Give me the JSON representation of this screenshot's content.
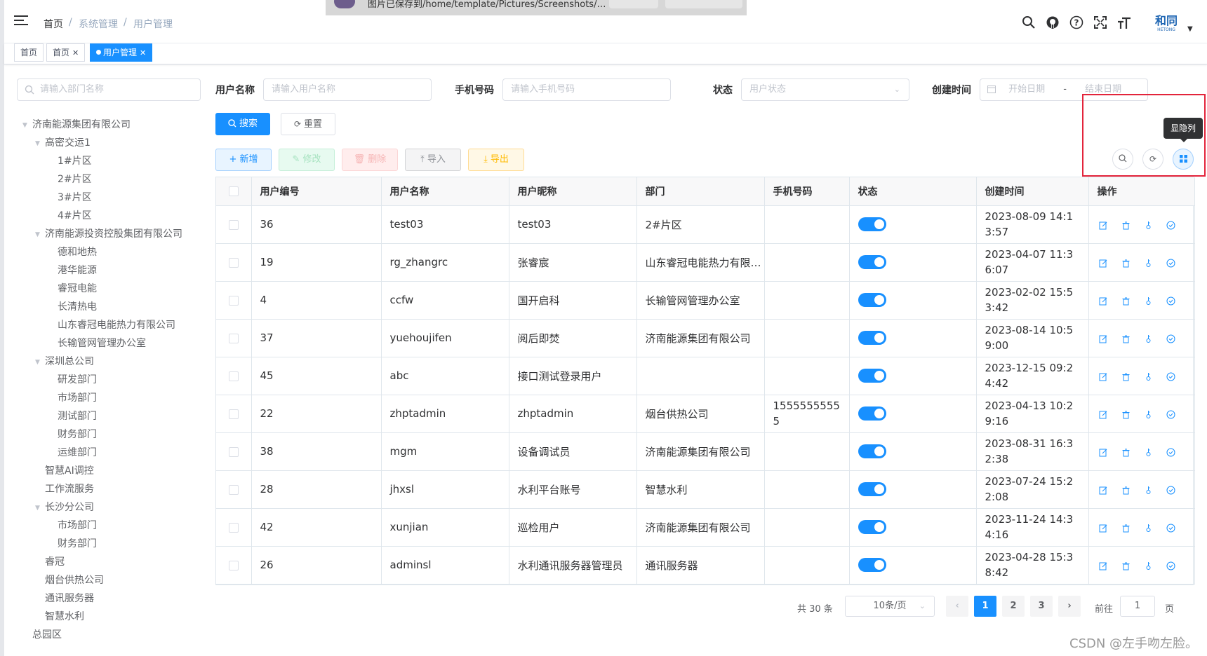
{
  "navbar": {
    "breadcrumb": [
      "首页",
      "系统管理",
      "用户管理"
    ],
    "separator": "/"
  },
  "notification": {
    "text": "图片已保存到/home/template/Pictures/Screenshots/…"
  },
  "logo": {
    "text": "和同",
    "subtext": "HETONG"
  },
  "tags": [
    {
      "label": "首页"
    },
    {
      "label": "首页"
    },
    {
      "label": "用户管理"
    }
  ],
  "dept_search": {
    "placeholder": "请输入部门名称"
  },
  "tree": [
    {
      "label": "济南能源集团有限公司",
      "level": 0,
      "expanded": true
    },
    {
      "label": "高密交运1",
      "level": 1,
      "expanded": true
    },
    {
      "label": "1#片区",
      "level": 2
    },
    {
      "label": "2#片区",
      "level": 2
    },
    {
      "label": "3#片区",
      "level": 2
    },
    {
      "label": "4#片区",
      "level": 2
    },
    {
      "label": "济南能源投资控股集团有限公司",
      "level": 1,
      "expanded": true
    },
    {
      "label": "德和地热",
      "level": 2
    },
    {
      "label": "港华能源",
      "level": 2
    },
    {
      "label": "睿冠电能",
      "level": 2
    },
    {
      "label": "长清热电",
      "level": 2
    },
    {
      "label": "山东睿冠电能热力有限公司",
      "level": 2
    },
    {
      "label": "长输管网管理办公室",
      "level": 2
    },
    {
      "label": "深圳总公司",
      "level": 1,
      "expanded": true
    },
    {
      "label": "研发部门",
      "level": 2
    },
    {
      "label": "市场部门",
      "level": 2
    },
    {
      "label": "测试部门",
      "level": 2
    },
    {
      "label": "财务部门",
      "level": 2
    },
    {
      "label": "运维部门",
      "level": 2
    },
    {
      "label": "智慧AI调控",
      "level": 1
    },
    {
      "label": "工作流服务",
      "level": 1
    },
    {
      "label": "长沙分公司",
      "level": 1,
      "expanded": true
    },
    {
      "label": "市场部门",
      "level": 2
    },
    {
      "label": "财务部门",
      "level": 2
    },
    {
      "label": "睿冠",
      "level": 1
    },
    {
      "label": "烟台供热公司",
      "level": 1
    },
    {
      "label": "通讯服务器",
      "level": 1
    },
    {
      "label": "智慧水利",
      "level": 1
    },
    {
      "label": "总园区",
      "level": 0
    }
  ],
  "filters": {
    "username_label": "用户名称",
    "username_placeholder": "请输入用户名称",
    "phone_label": "手机号码",
    "phone_placeholder": "请输入手机号码",
    "status_label": "状态",
    "status_placeholder": "用户状态",
    "created_label": "创建时间",
    "start_placeholder": "开始日期",
    "range_sep": "-",
    "end_placeholder": "结束日期"
  },
  "buttons": {
    "search": "搜索",
    "reset": "重置",
    "add": "新增",
    "edit": "修改",
    "delete": "删除",
    "import": "导入",
    "export": "导出"
  },
  "tooltip": "显隐列",
  "table": {
    "columns": [
      "用户编号",
      "用户名称",
      "用户昵称",
      "部门",
      "手机号码",
      "状态",
      "创建时间",
      "操作"
    ],
    "rows": [
      {
        "id": "36",
        "username": "test03",
        "nickname": "test03",
        "dept": "2#片区",
        "phone": "",
        "status": true,
        "created": "2023-08-09 14:13:57"
      },
      {
        "id": "19",
        "username": "rg_zhangrc",
        "nickname": "张睿宸",
        "dept": "山东睿冠电能热力有限公司",
        "phone": "",
        "status": true,
        "created": "2023-04-07 11:36:07"
      },
      {
        "id": "4",
        "username": "ccfw",
        "nickname": "国开启科",
        "dept": "长输管网管理办公室",
        "phone": "",
        "status": true,
        "created": "2023-02-02 15:53:42"
      },
      {
        "id": "37",
        "username": "yuehoujifen",
        "nickname": "阅后即焚",
        "dept": "济南能源集团有限公司",
        "phone": "",
        "status": true,
        "created": "2023-08-14 10:59:00"
      },
      {
        "id": "45",
        "username": "abc",
        "nickname": "接口测试登录用户",
        "dept": "",
        "phone": "",
        "status": true,
        "created": "2023-12-15 09:24:42"
      },
      {
        "id": "22",
        "username": "zhptadmin",
        "nickname": "zhptadmin",
        "dept": "烟台供热公司",
        "phone": "15555555555",
        "status": true,
        "created": "2023-04-13 10:29:16"
      },
      {
        "id": "38",
        "username": "mgm",
        "nickname": "设备调试员",
        "dept": "济南能源集团有限公司",
        "phone": "",
        "status": true,
        "created": "2023-08-31 16:32:38"
      },
      {
        "id": "28",
        "username": "jhxsl",
        "nickname": "水利平台账号",
        "dept": "智慧水利",
        "phone": "",
        "status": true,
        "created": "2023-07-24 15:22:08"
      },
      {
        "id": "42",
        "username": "xunjian",
        "nickname": "巡检用户",
        "dept": "济南能源集团有限公司",
        "phone": "",
        "status": true,
        "created": "2023-11-24 14:34:16"
      },
      {
        "id": "26",
        "username": "adminsl",
        "nickname": "水利通讯服务器管理员",
        "dept": "通讯服务器",
        "phone": "",
        "status": true,
        "created": "2023-04-28 15:38:42"
      }
    ]
  },
  "pagination": {
    "total_text": "共 30 条",
    "page_size": "10条/页",
    "pages": [
      "1",
      "2",
      "3"
    ],
    "current": "1",
    "goto_label": "前往",
    "goto_value": "1",
    "page_suffix": "页"
  },
  "watermark": "CSDN @左手吻左脸。"
}
